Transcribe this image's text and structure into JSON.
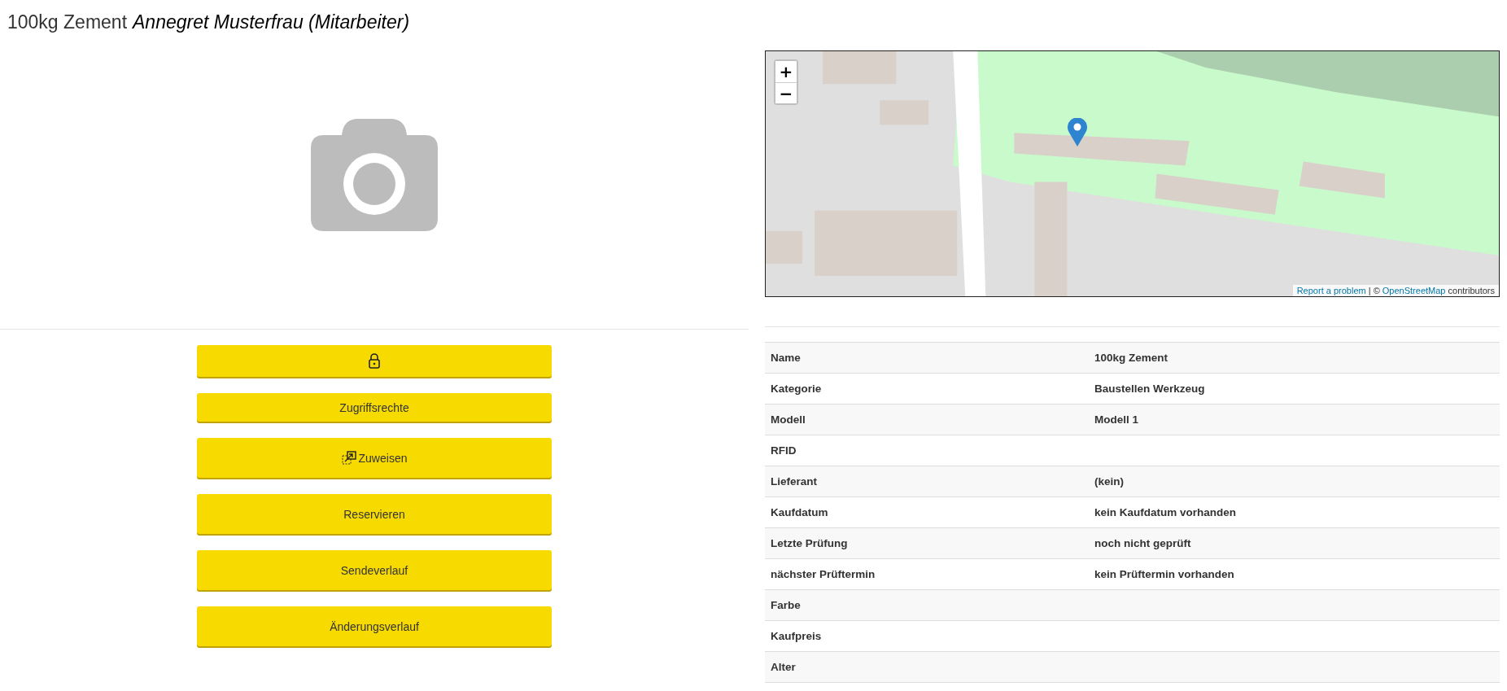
{
  "title": {
    "name": "100kg Zement",
    "assignee": "Annegret Musterfrau (Mitarbeiter)"
  },
  "map": {
    "zoom_in": "+",
    "zoom_out": "−",
    "attribution": {
      "report": "Report a problem",
      "separator": " | © ",
      "osm": "OpenStreetMap",
      "suffix": " contributors"
    }
  },
  "buttons": [
    {
      "kind": "lock"
    },
    {
      "kind": "compact",
      "label": "Zugriffsrechte"
    },
    {
      "kind": "assign",
      "label": "Zuweisen"
    },
    {
      "kind": "large",
      "label": "Reservieren"
    },
    {
      "kind": "large",
      "label": "Sendeverlauf"
    },
    {
      "kind": "large",
      "label": "Änderungsverlauf"
    }
  ],
  "details": [
    {
      "label": "Name",
      "value": "100kg Zement"
    },
    {
      "label": "Kategorie",
      "value": "Baustellen Werkzeug"
    },
    {
      "label": "Modell",
      "value": "Modell 1"
    },
    {
      "label": "RFID"
    },
    {
      "label": "Lieferant",
      "value": "(kein)"
    },
    {
      "label": "Kaufdatum",
      "value": "kein Kaufdatum vorhanden"
    },
    {
      "label": "Letzte Prüfung",
      "value": "noch nicht geprüft"
    },
    {
      "label": "nächster Prüftermin",
      "value": "kein Prüftermin vorhanden"
    },
    {
      "label": "Farbe"
    },
    {
      "label": "Kaufpreis"
    },
    {
      "label": "Alter"
    }
  ]
}
